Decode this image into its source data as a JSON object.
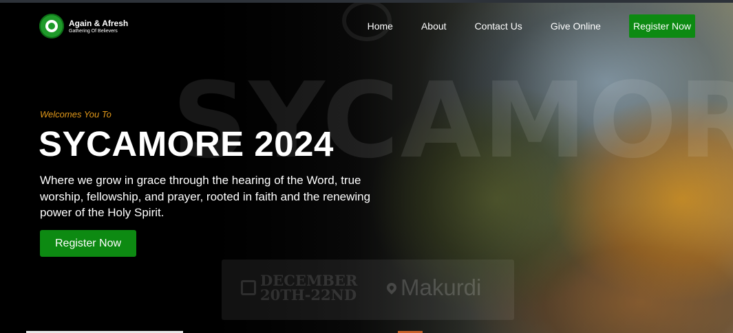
{
  "brand": {
    "name": "Again & Afresh",
    "tagline": "Gathering Of Believers",
    "accent_color": "#0d8a12",
    "highlight_color": "#e49a1a"
  },
  "nav": {
    "links": [
      "Home",
      "About",
      "Contact Us",
      "Give Online"
    ],
    "cta_label": "Register Now"
  },
  "hero": {
    "eyebrow": "Welcomes You To",
    "title": "SYCAMORE 2024",
    "description": "Where we grow in grace through the hearing of the Word, true worship, fellowship, and prayer, rooted in faith and the renewing power of the Holy Spirit.",
    "cta_label": "Register Now",
    "background_word": "SYCAMORE"
  },
  "event": {
    "date_line1": "DECEMBER",
    "date_line2": "20TH-22ND",
    "location": "Makurdi",
    "calendar_icon": "calendar-icon",
    "location_icon": "map-pin-icon"
  }
}
